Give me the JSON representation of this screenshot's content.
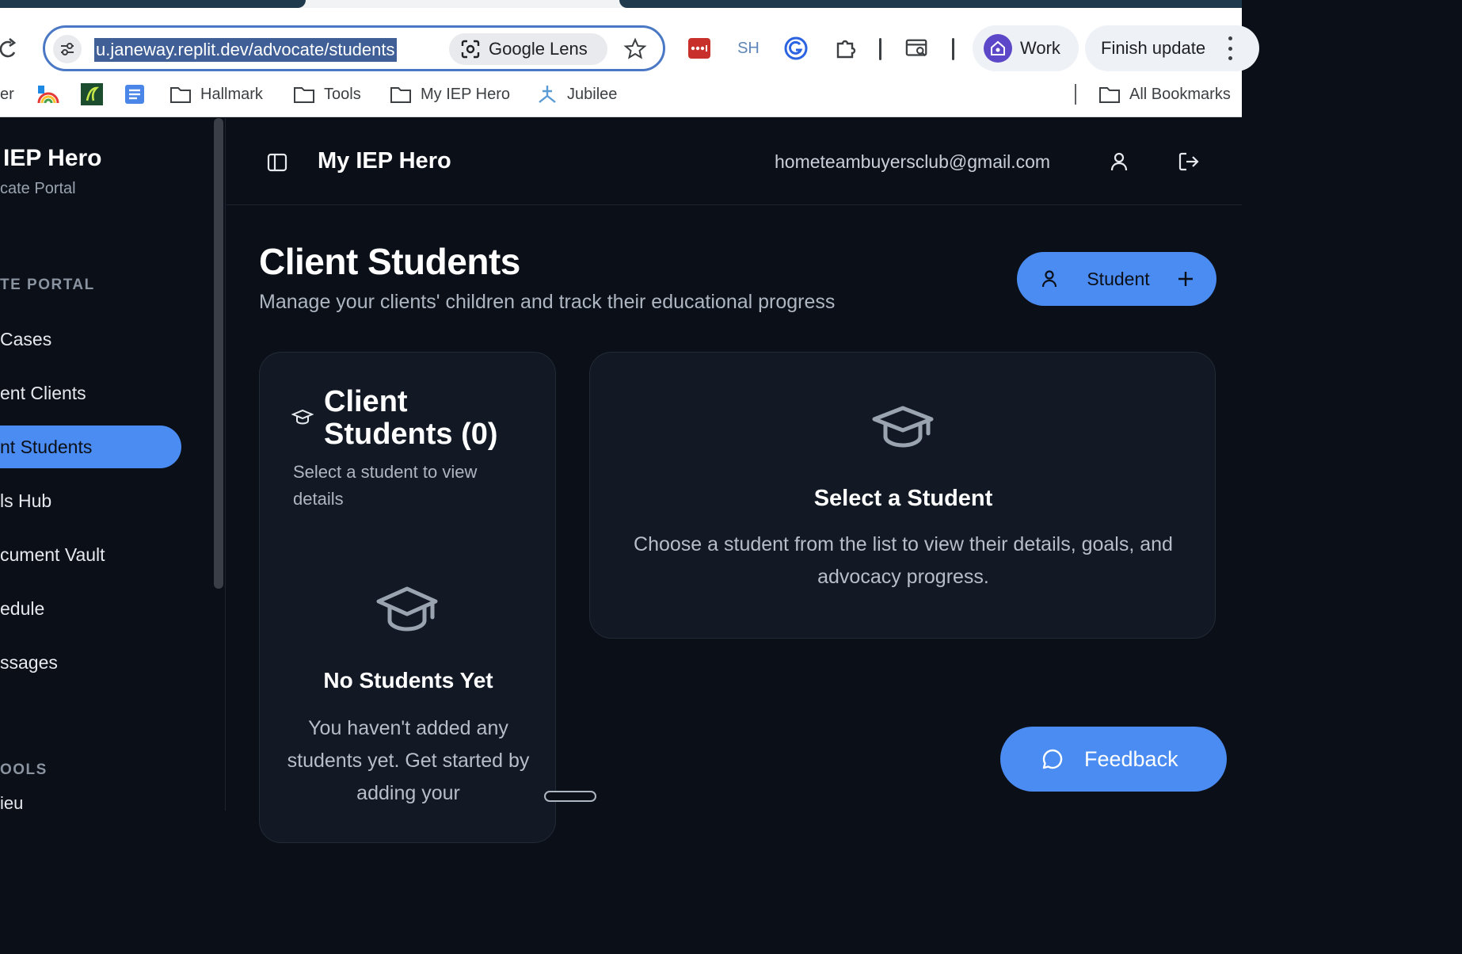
{
  "browser": {
    "url": "u.janeway.replit.dev/advocate/students",
    "lens_label": "Google Lens",
    "extensions": {
      "sh_label": "SH"
    },
    "profile_label": "Work",
    "update_label": "Finish update",
    "bookmarks": [
      {
        "label": "er",
        "icon": "truncated"
      },
      {
        "label": "",
        "icon": "rainbow-icon"
      },
      {
        "label": "",
        "icon": "r-logo-icon"
      },
      {
        "label": "",
        "icon": "doc-icon"
      },
      {
        "label": "Hallmark",
        "icon": "folder-icon"
      },
      {
        "label": "Tools",
        "icon": "folder-icon"
      },
      {
        "label": "My IEP Hero",
        "icon": "folder-icon"
      },
      {
        "label": "Jubilee",
        "icon": "jubilee-icon"
      },
      {
        "label": "All Bookmarks",
        "icon": "folder-icon"
      }
    ]
  },
  "sidebar": {
    "brand_title": "IEP Hero",
    "brand_subtitle": "cate Portal",
    "section_portal": "TE PORTAL",
    "items": [
      {
        "label": "Cases",
        "active": false
      },
      {
        "label": "ent Clients",
        "active": false
      },
      {
        "label": "nt Students",
        "active": true
      },
      {
        "label": "ls Hub",
        "active": false
      },
      {
        "label": "cument Vault",
        "active": false
      },
      {
        "label": "edule",
        "active": false
      },
      {
        "label": "ssages",
        "active": false
      }
    ],
    "section_tools": "OOLS",
    "partial_item": "ieu"
  },
  "header": {
    "title": "My IEP Hero",
    "email": "hometeambuyersclub@gmail.com"
  },
  "page": {
    "title": "Client Students",
    "subtitle": "Manage your clients' children and track their educational progress",
    "add_button_label": "Student"
  },
  "list_card": {
    "title": "Client Students (0)",
    "description": "Select a student to view details",
    "empty_title": "No Students Yet",
    "empty_description": "You haven't added any students yet. Get started by adding your"
  },
  "detail_card": {
    "title": "Select a Student",
    "description": "Choose a student from the list to view their details, goals, and advocacy progress."
  },
  "feedback": {
    "label": "Feedback"
  },
  "colors": {
    "accent": "#4b8cf2",
    "background": "#0b0f17",
    "card": "#121924"
  }
}
